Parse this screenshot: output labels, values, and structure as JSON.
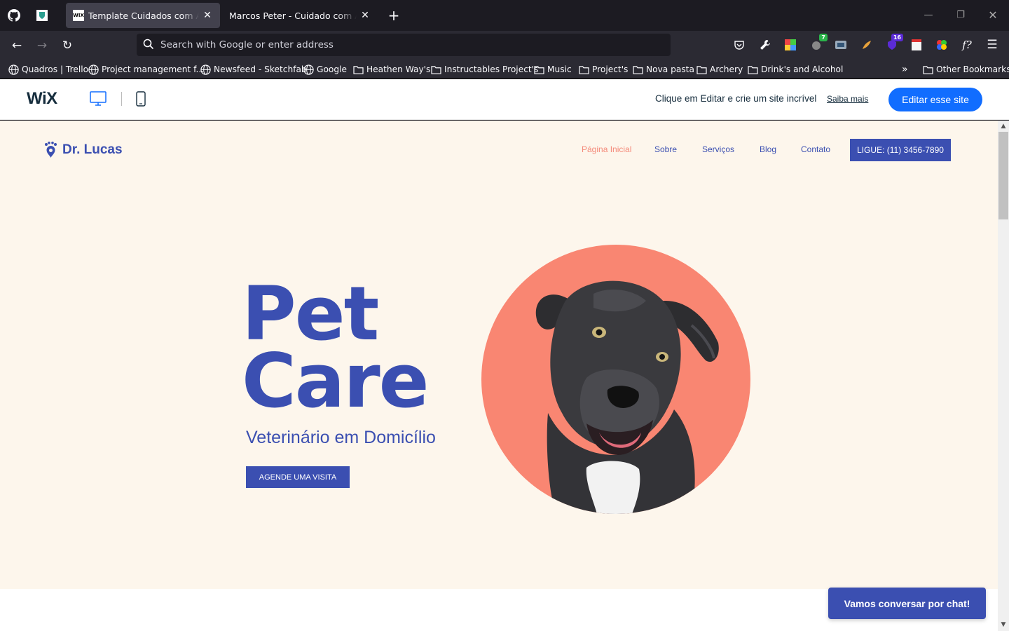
{
  "tabs": [
    {
      "title": "Template Cuidados com Animais",
      "active": true,
      "favicon": "WIX"
    },
    {
      "title": "Marcos Peter - Cuidado com Animais",
      "active": false
    }
  ],
  "urlbar": {
    "placeholder": "Search with Google or enter address"
  },
  "extensions": [
    {
      "icon": "pocket-icon"
    },
    {
      "icon": "wrench-icon"
    },
    {
      "icon": "color-grid-icon"
    },
    {
      "icon": "extension-badge-icon",
      "badge": "7",
      "badge_color": "#2ab34a"
    },
    {
      "icon": "screenshot-icon"
    },
    {
      "icon": "brush-icon"
    },
    {
      "icon": "shield-badge-icon",
      "badge": "16",
      "badge_color": "#5b2bd6"
    },
    {
      "icon": "note-icon"
    },
    {
      "icon": "color-wheel-icon"
    },
    {
      "icon": "font-finder-icon",
      "label": "f?"
    }
  ],
  "bookmarks": [
    {
      "label": "Quadros | Trello",
      "icon": "globe-icon"
    },
    {
      "label": "Project management f...",
      "icon": "globe-icon"
    },
    {
      "label": "Newsfeed - Sketchfab",
      "icon": "globe-icon"
    },
    {
      "label": "Google",
      "icon": "globe-icon"
    },
    {
      "label": "Heathen Way's",
      "icon": "folder-icon"
    },
    {
      "label": "Instructables Project's",
      "icon": "folder-icon"
    },
    {
      "label": "Music",
      "icon": "folder-icon"
    },
    {
      "label": "Project's",
      "icon": "folder-icon"
    },
    {
      "label": "Nova pasta",
      "icon": "folder-icon"
    },
    {
      "label": "Archery",
      "icon": "folder-icon"
    },
    {
      "label": "Drink's and Alcohol",
      "icon": "folder-icon"
    }
  ],
  "other_bookmarks": "Other Bookmarks",
  "wix": {
    "logo": "WiX",
    "message": "Clique em Editar e crie um site incrível",
    "learn_more": "Saiba mais",
    "edit_button": "Editar esse site",
    "accent": "#116dff"
  },
  "site": {
    "brand": "Dr. Lucas",
    "nav": [
      "Página Inicial",
      "Sobre",
      "Serviços",
      "Blog",
      "Contato"
    ],
    "call_button": "LIGUE: (11) 3456-7890",
    "hero_line1": "Pet",
    "hero_line2": "Care",
    "hero_sub": "Veterinário em Domicílio",
    "cta": "AGENDE UMA VISITA",
    "chat": "Vamos conversar por chat!",
    "colors": {
      "primary": "#3b4fb1",
      "accent": "#f98672",
      "background": "#fdf6ec"
    }
  }
}
